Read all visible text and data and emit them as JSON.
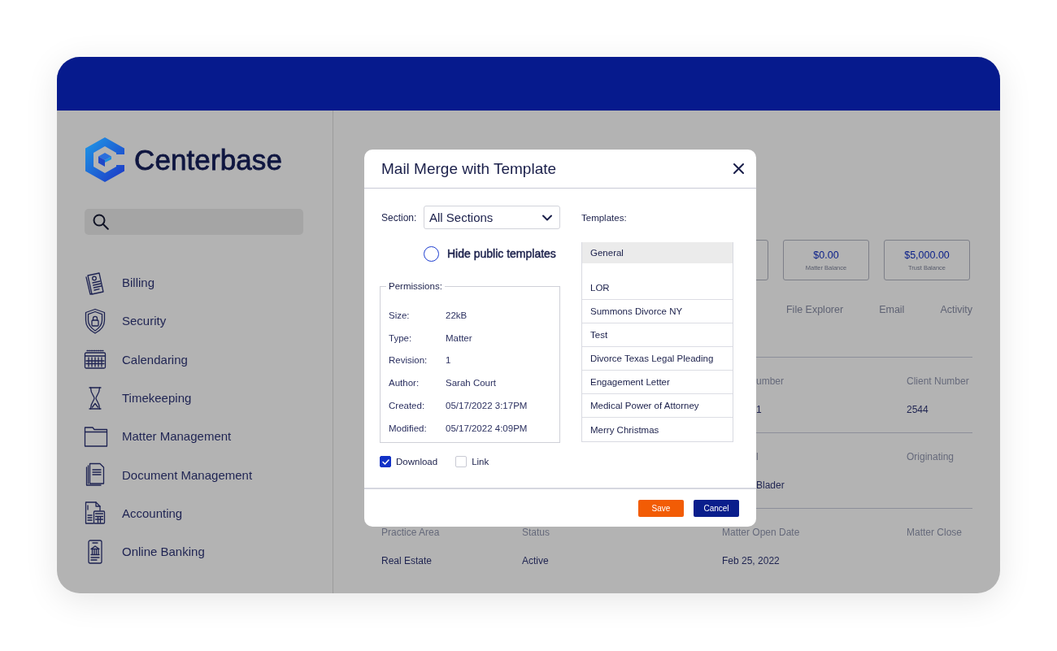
{
  "sidebar": {
    "brand": "Centerbase",
    "nav_items": [
      {
        "label": "Billing"
      },
      {
        "label": "Security"
      },
      {
        "label": "Calendaring"
      },
      {
        "label": "Timekeeping"
      },
      {
        "label": "Matter Management"
      },
      {
        "label": "Document Management"
      },
      {
        "label": "Accounting"
      },
      {
        "label": "Online Banking"
      }
    ]
  },
  "main": {
    "balances": [
      {
        "amount": "$0.00",
        "label": "Matter Balance"
      },
      {
        "amount": "$5,000.00",
        "label": "Trust Balance"
      }
    ],
    "tabs": [
      {
        "label": "File Explorer"
      },
      {
        "label": "Email"
      },
      {
        "label": "Activity"
      }
    ],
    "detail_sections": [
      {
        "column_3": {
          "label": "umber",
          "value": "1"
        },
        "column_4": {
          "label": "Client Number",
          "value": "2544"
        }
      },
      {
        "column_3": {
          "label": "l",
          "value": "Blader"
        },
        "column_4": {
          "label": "Originating"
        }
      },
      {
        "column_1": {
          "label": "Practice Area",
          "value": "Real Estate"
        },
        "column_2": {
          "label": "Status",
          "value": "Active"
        },
        "column_3": {
          "label": "Matter Open Date",
          "value": "Feb 25, 2022"
        },
        "column_4": {
          "label": "Matter Close"
        }
      }
    ]
  },
  "dialog": {
    "title": "Mail Merge with Template",
    "section": {
      "label": "Section:",
      "value": "All Sections"
    },
    "hide_public_templates": {
      "label": "Hide public templates",
      "checked": false
    },
    "permissions": {
      "legend": "Permissions:",
      "rows": [
        {
          "label": "Size:",
          "value": "22kB"
        },
        {
          "label": "Type:",
          "value": "Matter"
        },
        {
          "label": "Revision:",
          "value": "1"
        },
        {
          "label": "Author:",
          "value": "Sarah Court"
        },
        {
          "label": "Created:",
          "value": "05/17/2022 3:17PM"
        },
        {
          "label": "Modified:",
          "value": "05/17/2022 4:09PM"
        }
      ]
    },
    "options": [
      {
        "label": "Download",
        "checked": true
      },
      {
        "label": "Link",
        "checked": false
      }
    ],
    "templates": {
      "label": "Templates:",
      "items": [
        {
          "label": "General",
          "selected": true
        },
        {
          "label": "LOR",
          "selected": false
        },
        {
          "label": "Summons Divorce NY",
          "selected": false
        },
        {
          "label": "Test",
          "selected": false
        },
        {
          "label": "Divorce Texas Legal Pleading",
          "selected": false
        },
        {
          "label": "Engagement Letter",
          "selected": false
        },
        {
          "label": "Medical Power of Attorney",
          "selected": false
        },
        {
          "label": "Merry Christmas",
          "selected": false
        }
      ]
    },
    "buttons": [
      {
        "label": "Save",
        "kind": "primary"
      },
      {
        "label": "Cancel",
        "kind": "secondary"
      }
    ]
  }
}
